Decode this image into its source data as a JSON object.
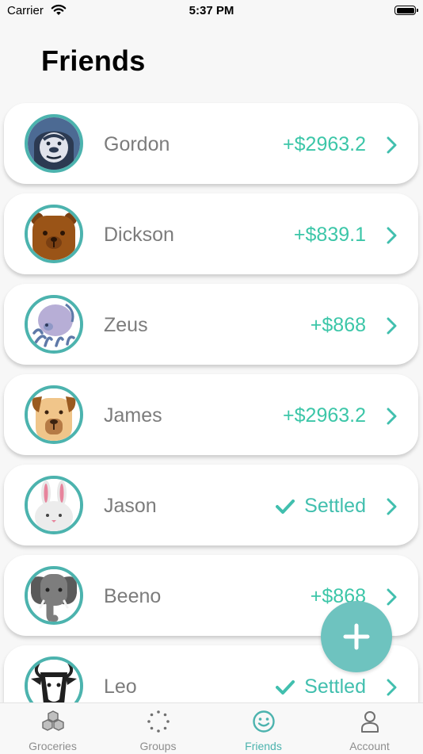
{
  "status_bar": {
    "carrier": "Carrier",
    "time": "5:37 PM"
  },
  "page": {
    "title": "Friends"
  },
  "friends": [
    {
      "name": "Gordon",
      "balance": "+$2963.2",
      "settled": false,
      "avatar": "gorilla-icon"
    },
    {
      "name": "Dickson",
      "balance": "+$839.1",
      "settled": false,
      "avatar": "bear-icon"
    },
    {
      "name": "Zeus",
      "balance": "+$868",
      "settled": false,
      "avatar": "octopus-icon"
    },
    {
      "name": "James",
      "balance": "+$2963.2",
      "settled": false,
      "avatar": "dog-icon"
    },
    {
      "name": "Jason",
      "balance": "Settled",
      "settled": true,
      "avatar": "rabbit-icon"
    },
    {
      "name": "Beeno",
      "balance": "+$868",
      "settled": false,
      "avatar": "elephant-icon"
    },
    {
      "name": "Leo",
      "balance": "Settled",
      "settled": true,
      "avatar": "goat-icon"
    }
  ],
  "tabs": [
    {
      "label": "Groceries",
      "icon": "boxes-icon",
      "active": false
    },
    {
      "label": "Groups",
      "icon": "dotted-circle-icon",
      "active": false
    },
    {
      "label": "Friends",
      "icon": "smiley-icon",
      "active": true
    },
    {
      "label": "Account",
      "icon": "person-icon",
      "active": false
    }
  ],
  "colors": {
    "accent": "#4cb3ae",
    "amount": "#3cc6a8",
    "fab": "#6ec3bf"
  }
}
